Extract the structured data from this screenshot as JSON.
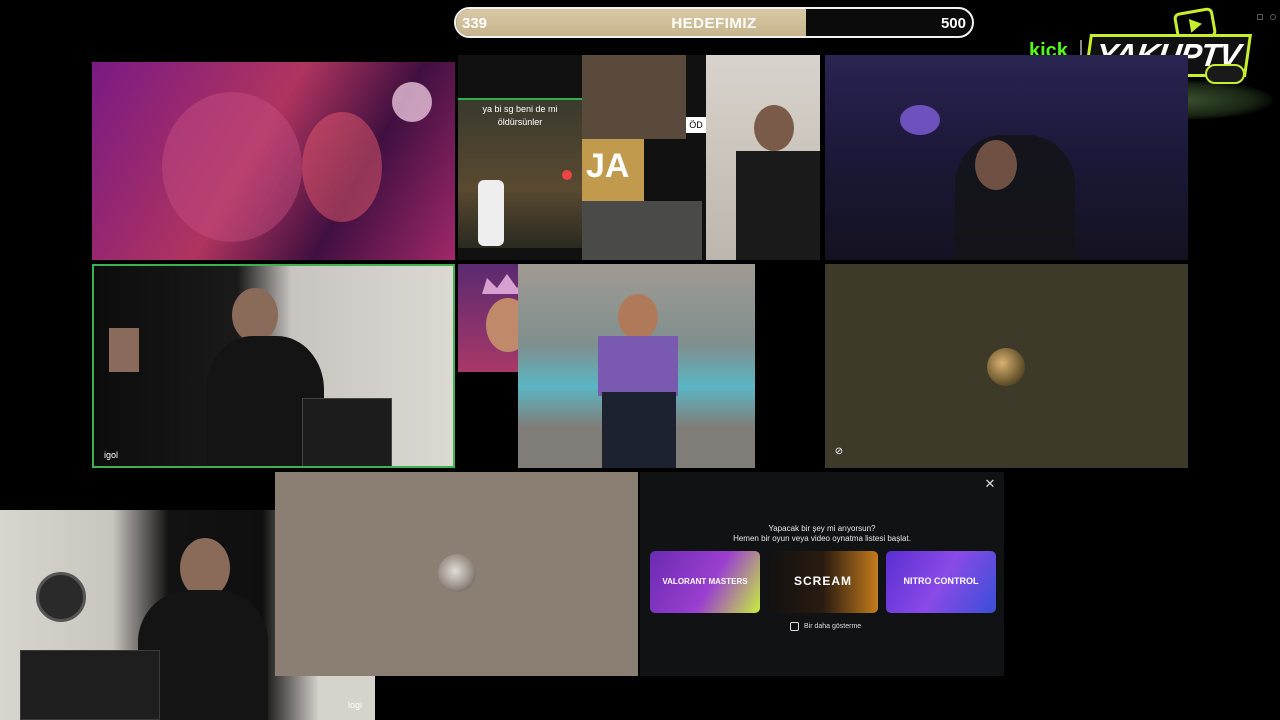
{
  "goal": {
    "current": "339",
    "title": "HEDEFIMIZ",
    "target": "500",
    "progress": 0.678
  },
  "brand": {
    "kick": "kick",
    "channel": "YAKUPTV"
  },
  "tiles": {
    "t2": {
      "caption_line1": "ya bi sg beni de mi",
      "caption_line2": "öldürsünler",
      "big_text": "JA",
      "side_text": "ÖD"
    },
    "t4": {
      "label": "igol"
    },
    "t7": {
      "label": "logi"
    }
  },
  "activity": {
    "title": "Yapacak bir şey mi arıyorsun?",
    "subtitle": "Hemen bir oyun veya video oynatma listesi başlat.",
    "cards": [
      {
        "name": "VALORANT MASTERS"
      },
      {
        "name": "SCREAM"
      },
      {
        "name": "NITRO CONTROL"
      }
    ],
    "dont_show": "Bir daha gösterme",
    "close": "✕"
  }
}
